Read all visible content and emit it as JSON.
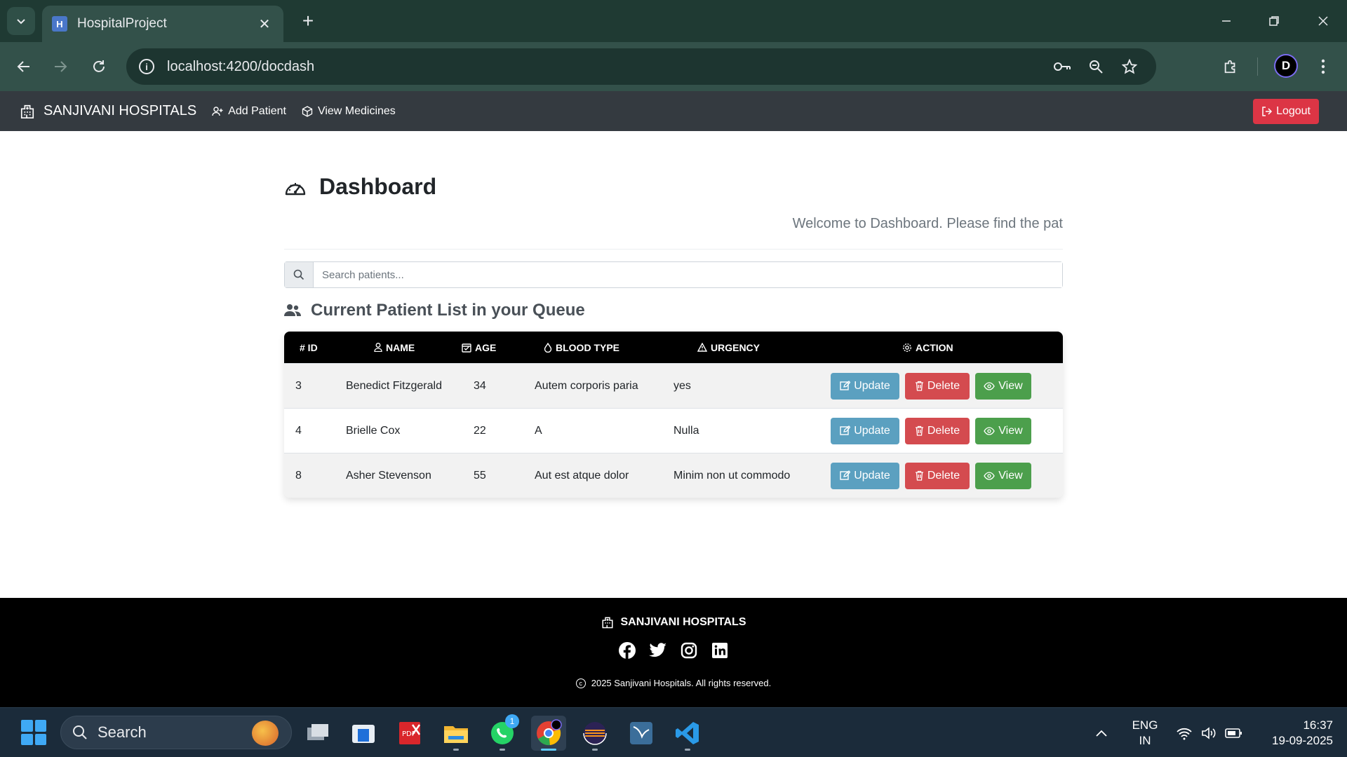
{
  "browser": {
    "tab_title": "HospitalProject",
    "url": "localhost:4200/docdash"
  },
  "navbar": {
    "brand": "SANJIVANI HOSPITALS",
    "links": [
      {
        "label": "Add Patient"
      },
      {
        "label": "View Medicines"
      }
    ],
    "logout_label": "Logout"
  },
  "page": {
    "title": "Dashboard",
    "welcome": "Welcome to Dashboard. Please find the pat",
    "search_placeholder": "Search patients...",
    "section_title": "Current Patient List in your Queue"
  },
  "table": {
    "headers": {
      "id": "# ID",
      "name": "NAME",
      "age": "AGE",
      "blood": "BLOOD TYPE",
      "urgency": "URGENCY",
      "action": "ACTION"
    },
    "rows": [
      {
        "id": "3",
        "name": "Benedict Fitzgerald",
        "age": "34",
        "blood": "Autem corporis paria",
        "urgency": "yes"
      },
      {
        "id": "4",
        "name": "Brielle Cox",
        "age": "22",
        "blood": "A",
        "urgency": "Nulla"
      },
      {
        "id": "8",
        "name": "Asher Stevenson",
        "age": "55",
        "blood": "Aut est atque dolor",
        "urgency": "Minim non ut commodo"
      }
    ],
    "actions": {
      "update": "Update",
      "delete": "Delete",
      "view": "View"
    }
  },
  "footer": {
    "brand": "SANJIVANI HOSPITALS",
    "copyright": "2025 Sanjivani Hospitals. All rights reserved.",
    "socials": [
      "facebook-icon",
      "twitter-icon",
      "instagram-icon",
      "linkedin-icon"
    ]
  },
  "taskbar": {
    "search_label": "Search",
    "whatsapp_badge": "1",
    "lang_1": "ENG",
    "lang_2": "IN",
    "time": "16:37",
    "date": "19-09-2025"
  },
  "colors": {
    "navbar_bg": "#343a40",
    "danger": "#dc3545",
    "info": "#5ba0c0",
    "success": "#4c9f4c",
    "table_head": "#000000",
    "chrome_bg": "#1f3a33"
  }
}
